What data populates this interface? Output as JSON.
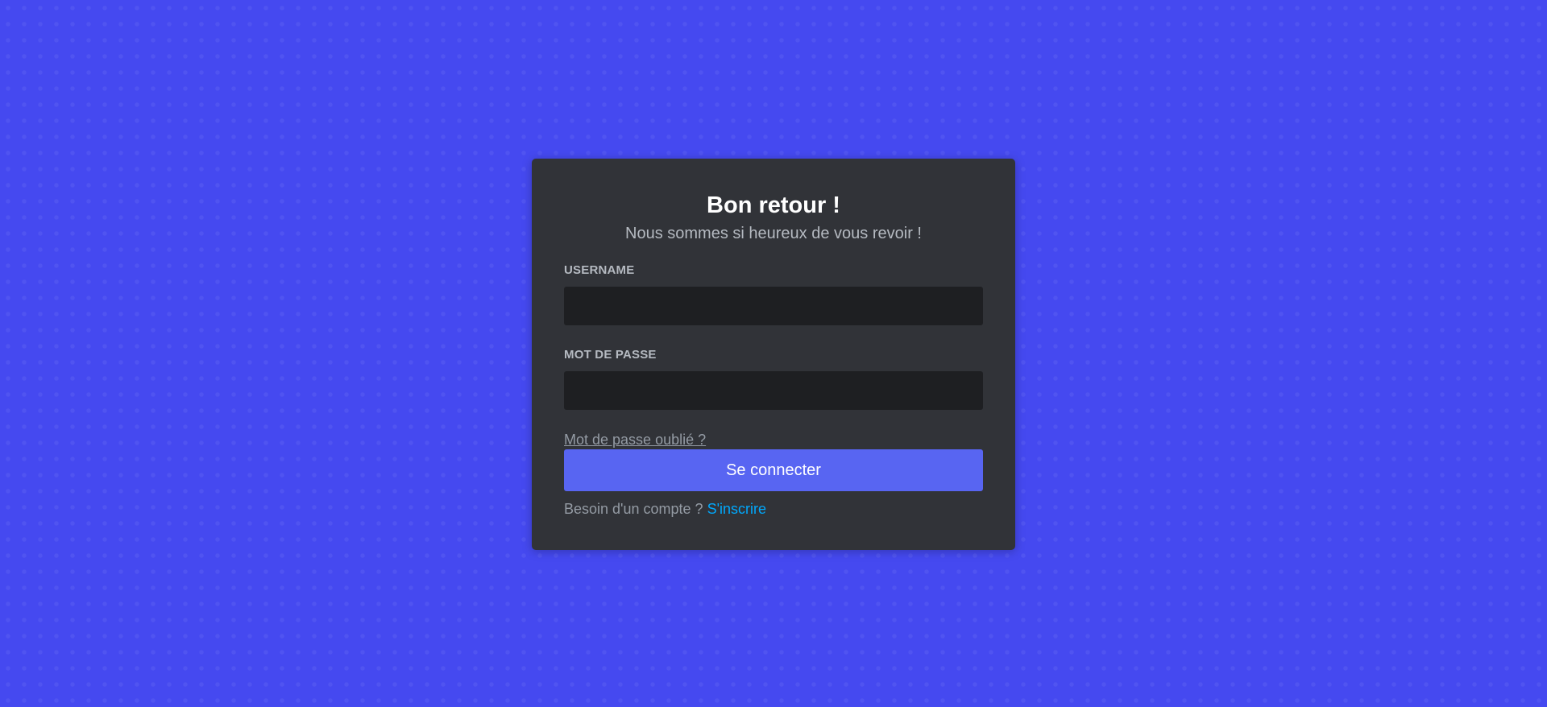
{
  "login": {
    "title": "Bon retour !",
    "subtitle": "Nous sommes si heureux de vous revoir !",
    "username": {
      "label": "USERNAME",
      "value": "",
      "placeholder": ""
    },
    "password": {
      "label": "MOT DE PASSE",
      "value": "",
      "placeholder": ""
    },
    "forgot_password_link": "Mot de passe oublié ?",
    "submit_label": "Se connecter",
    "register_prompt": "Besoin d'un compte ?",
    "register_link": "S'inscrire"
  },
  "colors": {
    "background": "#4549f0",
    "card": "#313338",
    "input": "#1e1f22",
    "button": "#5865f2",
    "link": "#00a8fc"
  }
}
